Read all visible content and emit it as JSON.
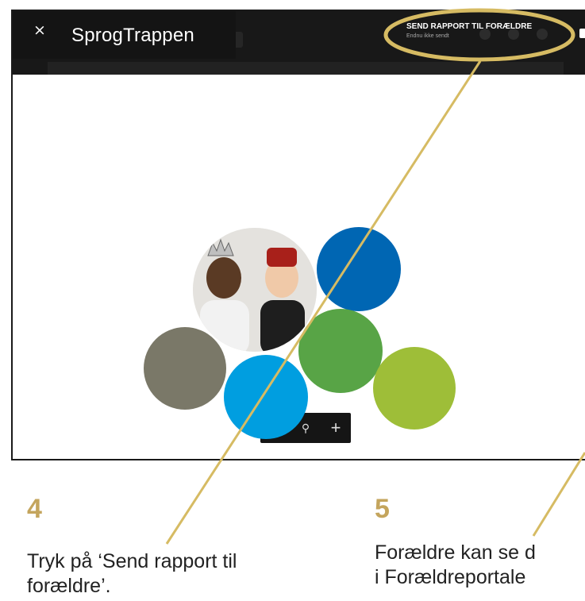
{
  "app": {
    "close_symbol": "×",
    "title": "SprogTrappen"
  },
  "header": {
    "send_report_label": "SEND RAPPORT TIL FORÆLDRE",
    "send_report_status": "Endnu ikke sendt"
  },
  "zoom": {
    "minus": "−",
    "magnifier": "⚲",
    "plus": "+"
  },
  "steps": [
    {
      "number": "4",
      "line1": "Tryk på ‘Send rapport til",
      "line2": "forældre’."
    },
    {
      "number": "5",
      "line1": "Forældre kan se d",
      "line2": "i Forældreportale"
    }
  ],
  "colors": {
    "gold": "#c4a55d",
    "dark_blue": "#0066b3",
    "green": "#58a446",
    "light_blue": "#009ee0",
    "lime": "#9ebe38",
    "gray": "#7a7868"
  },
  "icons": {
    "close": "close-icon",
    "zoom_out": "minus-icon",
    "zoom_search": "magnifier-icon",
    "zoom_in": "plus-icon"
  }
}
